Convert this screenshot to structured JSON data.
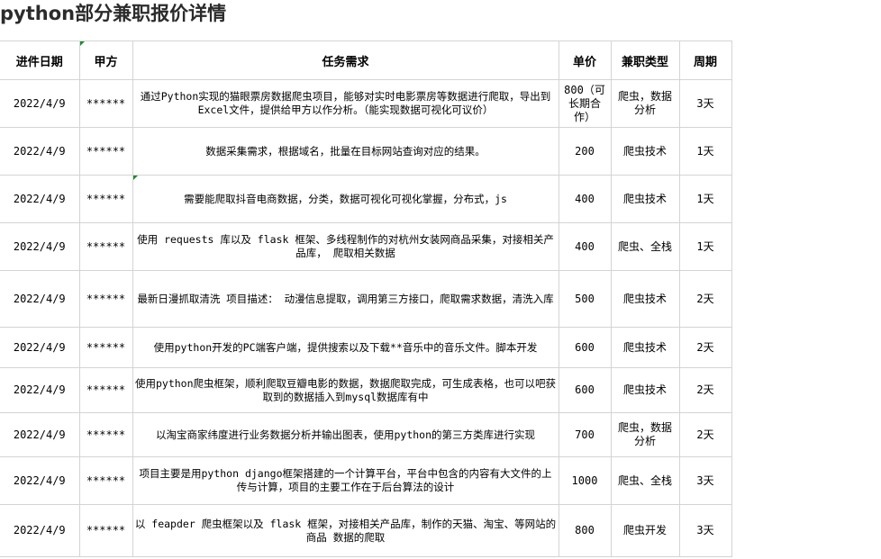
{
  "title": "python部分兼职报价详情",
  "columns": [
    "进件日期",
    "甲方",
    "任务需求",
    "单价",
    "兼职类型",
    "周期"
  ],
  "rows": [
    {
      "date": "2022/4/9",
      "client": "******",
      "task": "通过Python实现的猫眼票房数据爬虫项目，能够对实时电影票房等数据进行爬取，导出到Excel文件，提供给甲方以作分析。（能实现数据可视化可议价）",
      "price": "800（可长期合作）",
      "type": "爬虫，数据分析",
      "period": "3天"
    },
    {
      "date": "2022/4/9",
      "client": "******",
      "task": "数据采集需求，根据域名，批量在目标网站查询对应的结果。",
      "price": "200",
      "type": "爬虫技术",
      "period": "1天"
    },
    {
      "date": "2022/4/9",
      "client": "******",
      "task": "需要能爬取抖音电商数据，分类，数据可视化可视化掌握，分布式，js",
      "price": "400",
      "type": "爬虫技术",
      "period": "1天"
    },
    {
      "date": "2022/4/9",
      "client": "******",
      "task": "使用 requests 库以及 flask 框架、多线程制作的对杭州女装网商品采集，对接相关产品库， 爬取相关数据",
      "price": "400",
      "type": "爬虫、全栈",
      "period": "1天"
    },
    {
      "date": "2022/4/9",
      "client": "******",
      "task": "最新日漫抓取清洗 项目描述： 动漫信息提取，调用第三方接口，爬取需求数据，清洗入库",
      "price": "500",
      "type": "爬虫技术",
      "period": "2天"
    },
    {
      "date": "2022/4/9",
      "client": "******",
      "task": "使用python开发的PC端客户端，提供搜索以及下载**音乐中的音乐文件。脚本开发",
      "price": "600",
      "type": "爬虫技术",
      "period": "2天"
    },
    {
      "date": "2022/4/9",
      "client": "******",
      "task": "使用python爬虫框架，顺利爬取豆瓣电影的数据，数据爬取完成，可生成表格，也可以吧获取到的数据插入到mysql数据库有中",
      "price": "600",
      "type": "爬虫技术",
      "period": "2天"
    },
    {
      "date": "2022/4/9",
      "client": "******",
      "task": "以淘宝商家纬度进行业务数据分析并输出图表，使用python的第三方类库进行实现",
      "price": "700",
      "type": "爬虫，数据分析",
      "period": "2天"
    },
    {
      "date": "2022/4/9",
      "client": "******",
      "task": "项目主要是用python django框架搭建的一个计算平台，平台中包含的内容有大文件的上传与计算，项目的主要工作在于后台算法的设计",
      "price": "1000",
      "type": "爬虫、全栈",
      "period": "3天"
    },
    {
      "date": "2022/4/9",
      "client": "******",
      "task": "以 feapder 爬虫框架以及 flask 框架，对接相关产品库，制作的天猫、淘宝、等网站的商品 数据的爬取",
      "price": "800",
      "type": "爬虫开发",
      "period": "3天"
    }
  ]
}
